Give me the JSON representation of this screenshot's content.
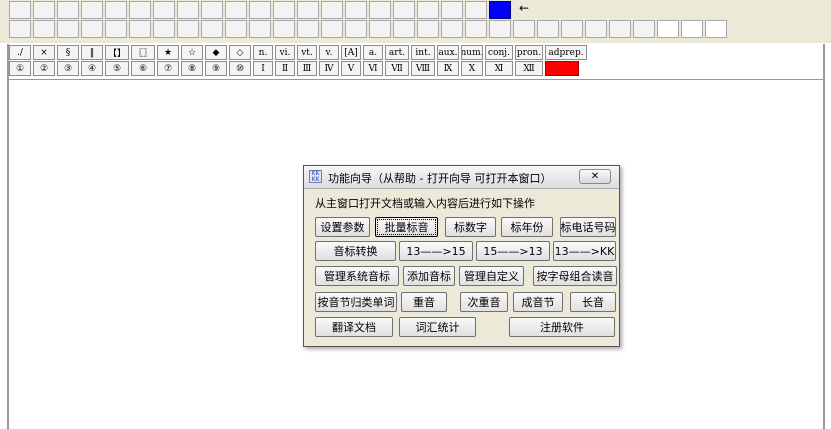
{
  "toolbar": {
    "arrow_glyph": "←",
    "symbols_row1": [
      "./",
      "×",
      "§",
      "‖",
      "【】",
      "〖〗",
      "★",
      "☆",
      "◆",
      "◇",
      "n.",
      "vi.",
      "vt.",
      "v.",
      "[A]",
      "a.",
      "art.",
      "int.",
      "aux.",
      "num.",
      "conj.",
      "pron.",
      "adprep."
    ],
    "symbols_row2": [
      "①",
      "②",
      "③",
      "④",
      "⑤",
      "⑥",
      "⑦",
      "⑧",
      "⑨",
      "⑩",
      "Ⅰ",
      "Ⅱ",
      "Ⅲ",
      "Ⅳ",
      "Ⅴ",
      "Ⅵ",
      "Ⅶ",
      "Ⅷ",
      "Ⅸ",
      "Ⅹ",
      "Ⅺ",
      "Ⅻ",
      ""
    ],
    "active_color": "#0000ff",
    "marker_color": "#ff0000"
  },
  "dialog": {
    "title": "功能向导（从帮助 - 打开向导 可打开本窗口）",
    "close_label": "✕",
    "instruction": "从主窗口打开文档或输入内容后进行如下操作",
    "buttons": {
      "settings": "设置参数",
      "batch_phonetic": "批量标音",
      "mark_numbers": "标数字",
      "mark_years": "标年份",
      "mark_phone": "标电话号码",
      "phonetic_convert": "音标转换",
      "c13_to_15": "13——>15",
      "c15_to_13": "15——>13",
      "c13_to_kk": "13——>KK",
      "manage_system": "管理系统音标",
      "add_phonetic": "添加音标",
      "manage_custom": "管理自定义",
      "letter_combo": "按字母组合读音",
      "syllable_classify": "按音节归类单词",
      "stress": "重音",
      "secondary_stress": "次重音",
      "syllabic": "成音节",
      "long_vowel": "长音",
      "translate_doc": "翻译文档",
      "vocab_stats": "词汇统计",
      "register": "注册软件"
    }
  }
}
